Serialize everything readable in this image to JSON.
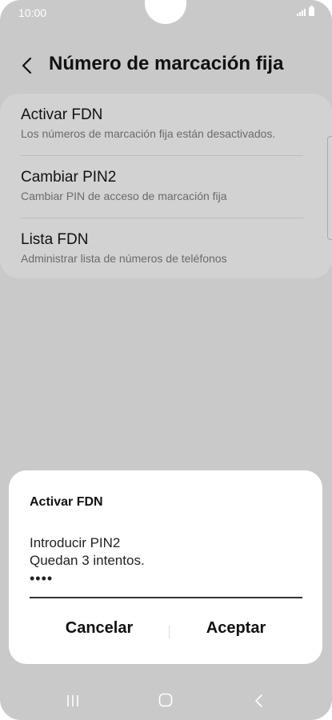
{
  "status_bar": {
    "time": "10:00"
  },
  "header": {
    "title": "Número de marcación fija",
    "back_icon": "chevron-left-icon"
  },
  "settings": {
    "items": [
      {
        "title": "Activar FDN",
        "description": "Los números de marcación fija están desactivados."
      },
      {
        "title": "Cambiar PIN2",
        "description": "Cambiar PIN de acceso de marcación fija"
      },
      {
        "title": "Lista FDN",
        "description": "Administrar lista de números de teléfonos"
      }
    ]
  },
  "dialog": {
    "title": "Activar FDN",
    "message_line1": "Introducir PIN2",
    "message_line2": "Quedan 3 intentos.",
    "pin_value": "••••",
    "cancel_label": "Cancelar",
    "accept_label": "Aceptar"
  },
  "nav_bar": {
    "icons": [
      "recents-icon",
      "home-icon",
      "back-icon"
    ]
  },
  "colors": {
    "background": "#c9c9c9",
    "dialog": "#ffffff",
    "text": "#111111",
    "secondary_text": "#6b6b6b"
  }
}
